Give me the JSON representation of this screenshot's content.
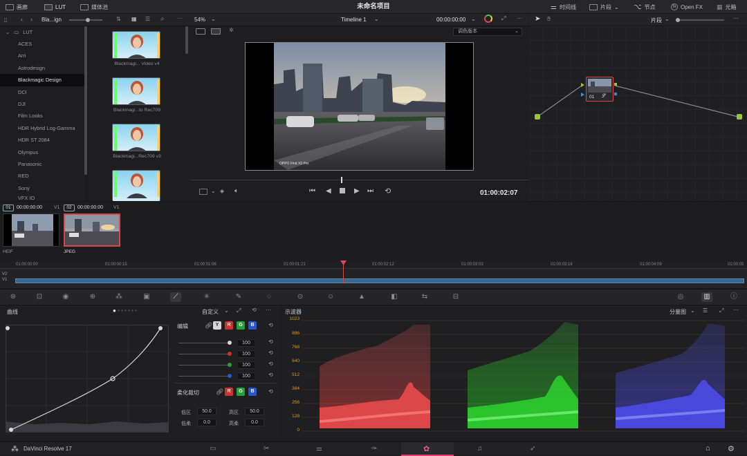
{
  "topbar": {
    "items": [
      {
        "label": "画廊",
        "icon": "gallery-icon"
      },
      {
        "label": "LUT",
        "icon": "lut-icon"
      },
      {
        "label": "媒体池",
        "icon": "media-pool-icon"
      }
    ],
    "project_title": "未命名项目",
    "right_items": [
      {
        "label": "时间线",
        "icon": "timeline-icon"
      },
      {
        "label": "片段",
        "icon": "clips-icon"
      },
      {
        "label": "节点",
        "icon": "nodes-icon"
      },
      {
        "label": "Open FX",
        "icon": "openfx-icon"
      },
      {
        "label": "光箱",
        "icon": "lightbox-icon"
      }
    ]
  },
  "lut_panel": {
    "breadcrumb": "Bla...ign",
    "root": "LUT",
    "items": [
      "ACES",
      "Arri",
      "Astrodesign",
      "Blackmagic Design",
      "DCI",
      "DJI",
      "Film Looks",
      "HDR Hybrid Log-Gamma",
      "HDR ST 2084",
      "Olympus",
      "Panasonic",
      "RED",
      "Sony",
      "VFX IO"
    ],
    "selected": "Blackmagic Design",
    "thumbs": [
      "Blackmagi... Video v4",
      "Blackmagi...to Rec709",
      "Blackmagi...Rec709 v3"
    ]
  },
  "viewer": {
    "zoom": "54%",
    "timeline_name": "Timeline 1",
    "timecode_top": "00:00:00:00",
    "version_dropdown": "调色版本",
    "watermark": "OPPO Find X3 Pro",
    "timecode": "01:00:02:07"
  },
  "node_panel": {
    "mode": "片段",
    "node_label": "01"
  },
  "clips": [
    {
      "index": "01",
      "timecode": "00:00:00:00",
      "track": "V1",
      "format": "HEIF"
    },
    {
      "index": "02",
      "timecode": "00:00:00:00",
      "track": "V1",
      "format": "JPEG"
    }
  ],
  "timeline": {
    "ticks": [
      "01:00:00:00",
      "01:00:00:15",
      "01:00:01:06",
      "01:00:01:21",
      "01:00:02:12",
      "01:00:03:03",
      "01:00:03:18",
      "01:00:04:09",
      "01:00:05"
    ],
    "tracks": [
      "V2",
      "V1"
    ]
  },
  "curves": {
    "title": "曲线",
    "mode": "自定义",
    "edit_label": "编辑",
    "channels": [
      "Y",
      "R",
      "G",
      "B"
    ],
    "values": [
      "100",
      "100",
      "100",
      "100"
    ],
    "soft_clip_label": "柔化裁切",
    "low_label": "低区",
    "low_value": "50.0",
    "high_label": "高区",
    "high_value": "50.0",
    "low_soft_label": "低柔",
    "low_soft_value": "0.0",
    "high_soft_label": "高柔",
    "high_soft_value": "0.0"
  },
  "scope": {
    "title": "示波器",
    "mode": "分量图",
    "scale": [
      "1023",
      "896",
      "768",
      "640",
      "512",
      "384",
      "256",
      "128",
      "0"
    ]
  },
  "bottombar": {
    "app_name": "DaVinci Resolve 17"
  },
  "colors": {
    "accent_red": "#e04848",
    "node_green": "#9ac23c"
  }
}
